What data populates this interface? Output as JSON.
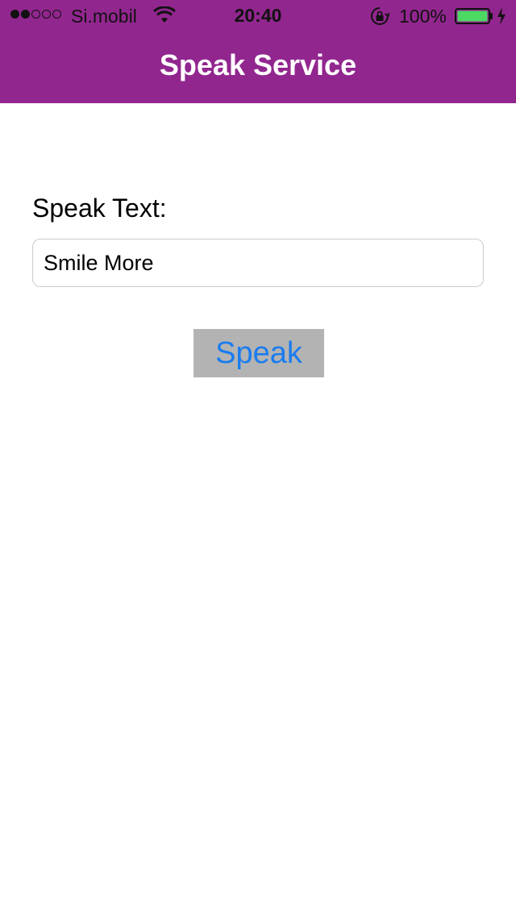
{
  "status_bar": {
    "signal_filled": 2,
    "signal_total": 5,
    "carrier": "Si.mobil",
    "time": "20:40",
    "battery_percent_label": "100%",
    "battery_level": 1.0,
    "icons": [
      "wifi-icon",
      "orientation-lock-icon",
      "battery-icon",
      "charging-icon"
    ]
  },
  "nav": {
    "title": "Speak Service"
  },
  "form": {
    "label": "Speak Text:",
    "input_value": "Smile More",
    "button_label": "Speak"
  },
  "colors": {
    "header_bg": "#92268f",
    "button_bg": "#b3b3b3",
    "button_text": "#1a7cf0",
    "battery_fill": "#4cd964"
  }
}
